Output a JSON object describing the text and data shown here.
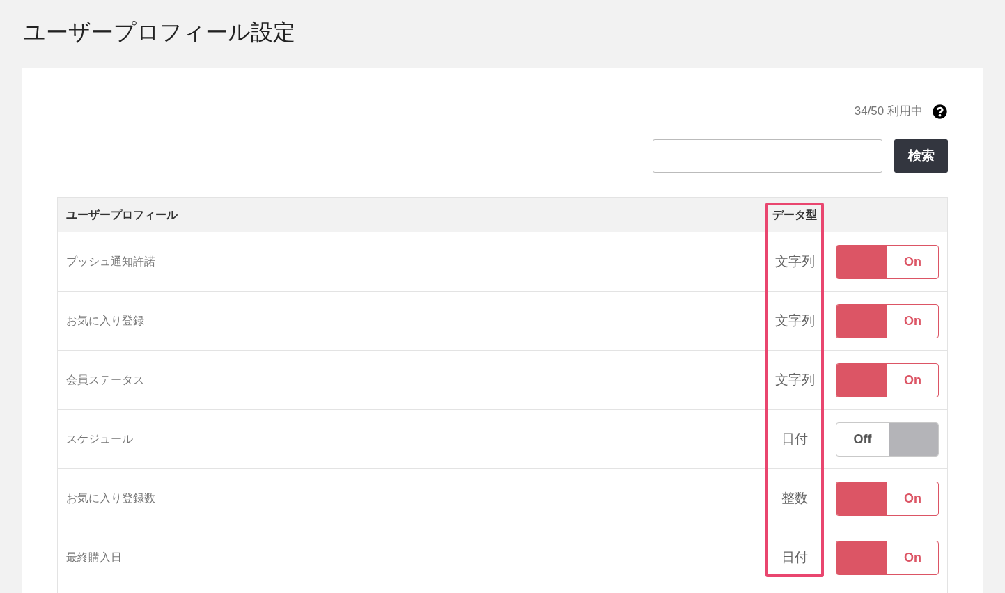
{
  "page": {
    "title": "ユーザープロフィール設定"
  },
  "usage": {
    "text": "34/50 利用中"
  },
  "search": {
    "button": "検索"
  },
  "table": {
    "columns": [
      {
        "label": "ユーザープロフィール",
        "highlighted": false
      },
      {
        "label": "データ型",
        "highlighted": true
      }
    ],
    "rows": [
      {
        "name": "プッシュ通知許諾",
        "data_type": "文字列",
        "toggle": {
          "on": true,
          "label": "On"
        }
      },
      {
        "name": "お気に入り登録",
        "data_type": "文字列",
        "toggle": {
          "on": true,
          "label": "On"
        }
      },
      {
        "name": "会員ステータス",
        "data_type": "文字列",
        "toggle": {
          "on": true,
          "label": "On"
        }
      },
      {
        "name": "スケジュール",
        "data_type": "日付",
        "toggle": {
          "on": false,
          "label": "Off"
        }
      },
      {
        "name": "お気に入り登録数",
        "data_type": "整数",
        "toggle": {
          "on": true,
          "label": "On"
        }
      },
      {
        "name": "最終購入日",
        "data_type": "日付",
        "toggle": {
          "on": true,
          "label": "On"
        }
      }
    ]
  }
}
